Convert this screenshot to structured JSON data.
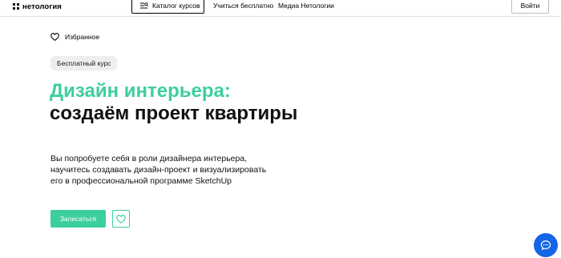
{
  "header": {
    "logo_text": "нетология",
    "catalog_label": "Каталог курсов",
    "nav": [
      "Учиться бесплатно",
      "Медиа Нетологии"
    ],
    "login_label": "Войти"
  },
  "favorites": {
    "label": "Избранное"
  },
  "course": {
    "badge": "Бесплатный курс",
    "title_accent": "Дизайн интерьера:",
    "title_rest": "создаём проект квартиры",
    "description": "Вы попробуете себя в роли дизайнера интерьера, научитесь создавать дизайн-проект и визуализировать его в профессиональной программе SketchUp",
    "signup_label": "Записаться"
  },
  "colors": {
    "accent": "#3ccf9c",
    "chat": "#1565e6"
  },
  "icons": {
    "logo": "logo-icon",
    "catalog": "catalog-list-icon",
    "favorites": "heart-outline-icon",
    "favorite_button": "heart-outline-icon",
    "chat": "chat-icon"
  }
}
